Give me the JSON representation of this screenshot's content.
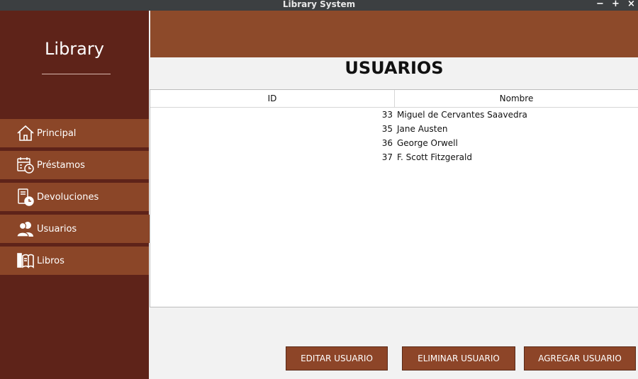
{
  "window": {
    "title": "Library System",
    "minimize": "−",
    "maximize": "+",
    "close": "×"
  },
  "sidebar": {
    "logo": "Library",
    "items": [
      {
        "label": "Principal",
        "icon": "home-icon"
      },
      {
        "label": "Préstamos",
        "icon": "calendar-icon"
      },
      {
        "label": "Devoluciones",
        "icon": "return-book-icon"
      },
      {
        "label": "Usuarios",
        "icon": "users-icon"
      },
      {
        "label": "Libros",
        "icon": "book-icon"
      }
    ]
  },
  "main": {
    "title": "USUARIOS",
    "table": {
      "headers": {
        "id": "ID",
        "name": "Nombre"
      },
      "rows": [
        {
          "id": "33",
          "name": "Miguel de Cervantes Saavedra"
        },
        {
          "id": "35",
          "name": "Jane Austen"
        },
        {
          "id": "36",
          "name": "George Orwell"
        },
        {
          "id": "37",
          "name": "F. Scott Fitzgerald"
        }
      ]
    },
    "buttons": {
      "edit": "EDITAR USUARIO",
      "delete": "ELIMINAR USUARIO",
      "add": "AGREGAR USUARIO"
    }
  },
  "colors": {
    "sidebar": "#5e2319",
    "accent": "#8b4628",
    "header": "#8d4a2a"
  }
}
